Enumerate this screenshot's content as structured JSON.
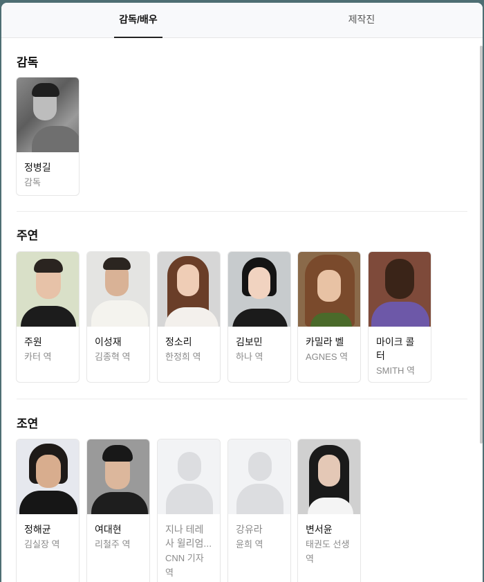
{
  "tabs": [
    {
      "label": "감독/배우",
      "active": true
    },
    {
      "label": "제작진",
      "active": false
    }
  ],
  "sections": {
    "director": {
      "title": "감독",
      "people": [
        {
          "name": "정병길",
          "role": "감독"
        }
      ]
    },
    "lead": {
      "title": "주연",
      "people": [
        {
          "name": "주원",
          "role": "카터 역"
        },
        {
          "name": "이성재",
          "role": "김종혁 역"
        },
        {
          "name": "정소리",
          "role": "한정희 역"
        },
        {
          "name": "김보민",
          "role": "하나 역"
        },
        {
          "name": "카밀라 벨",
          "role": "AGNES 역"
        },
        {
          "name": "마이크 콜 터",
          "role": "SMITH 역"
        }
      ]
    },
    "supporting": {
      "title": "조연",
      "people": [
        {
          "name": "정해균",
          "role": "김실장 역"
        },
        {
          "name": "여대현",
          "role": "리철주 역"
        },
        {
          "name": "지나 테레사 윌리엄...",
          "role": "CNN 기자 역"
        },
        {
          "name": "강유라",
          "role": "윤희 역"
        },
        {
          "name": "변서윤",
          "role": "태권도 선생 역"
        }
      ]
    }
  },
  "colors": {
    "accent_underline": "#222222",
    "placeholder_bg": "#f2f3f5",
    "placeholder_fg": "#dcdde0"
  }
}
